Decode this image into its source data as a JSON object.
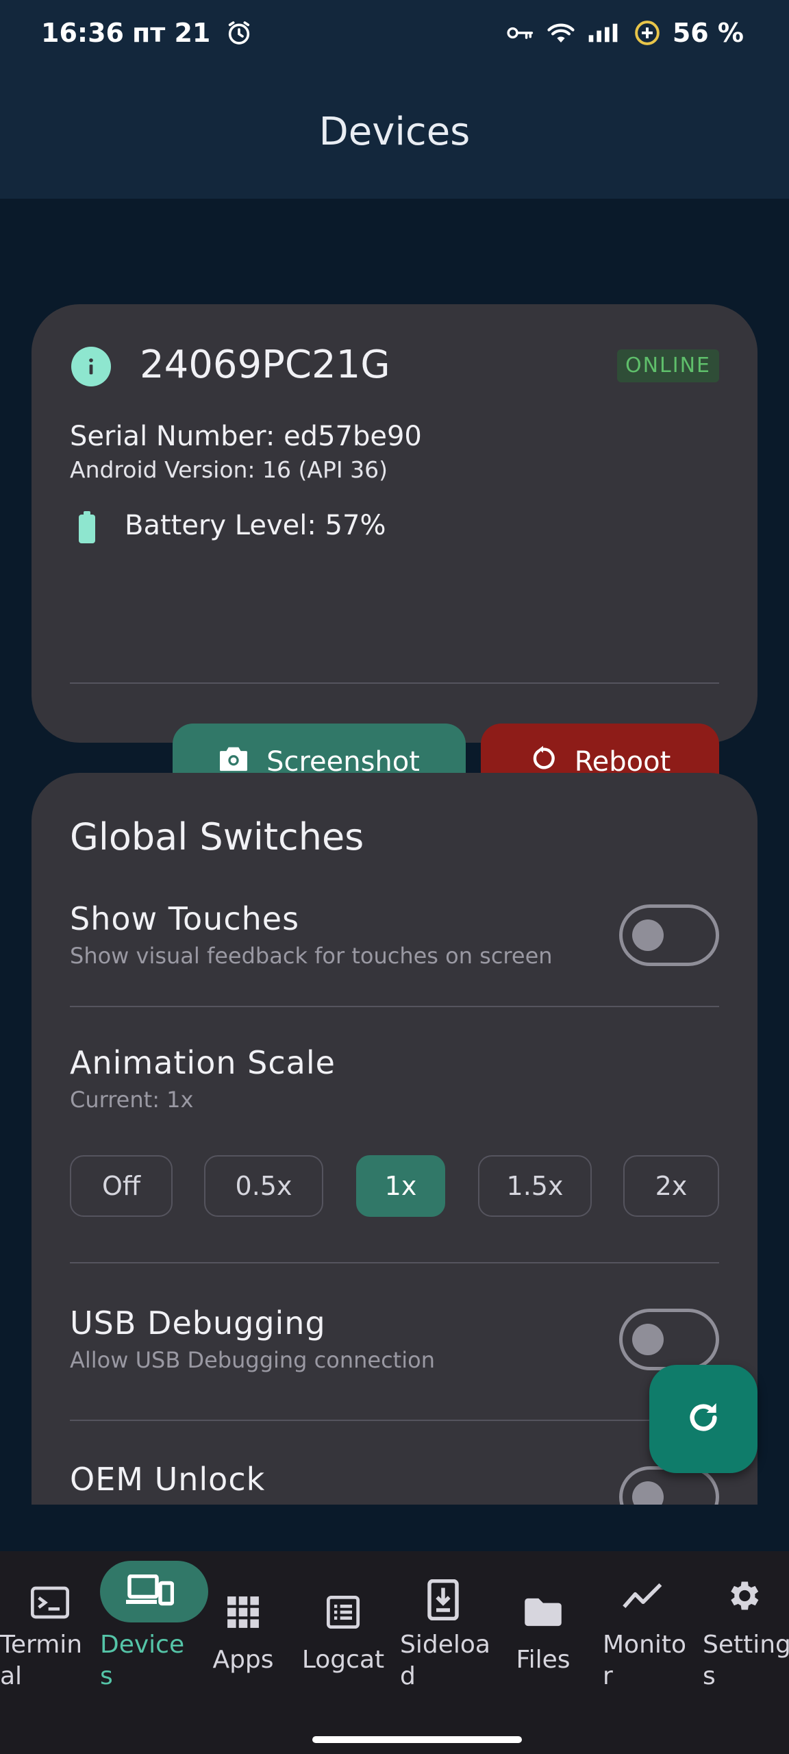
{
  "status_bar": {
    "time": "16:36",
    "date": "пт 21",
    "battery_percent": "56 %"
  },
  "app_bar": {
    "title": "Devices"
  },
  "device_card": {
    "model": "24069PC21G",
    "status": "ONLINE",
    "serial": "Serial Number: ed57be90",
    "android_version": "Android Version: 16 (API 36)",
    "battery": "Battery Level: 57%",
    "screenshot_label": "Screenshot",
    "reboot_label": "Reboot"
  },
  "switches": {
    "title": "Global Switches",
    "show_touches": {
      "title": "Show Touches",
      "subtitle": "Show visual feedback for touches on screen",
      "enabled": false
    },
    "animation_scale": {
      "title": "Animation Scale",
      "subtitle": "Current: 1x",
      "options": [
        "Off",
        "0.5x",
        "1x",
        "1.5x",
        "2x"
      ],
      "selected": "1x"
    },
    "usb_debugging": {
      "title": "USB Debugging",
      "subtitle": "Allow USB Debugging connection",
      "enabled": false
    },
    "oem_unlock": {
      "title": "OEM Unlock",
      "enabled": false
    }
  },
  "fab": {
    "icon": "refresh-icon"
  },
  "nav": {
    "items": [
      {
        "label": "Termin\nal",
        "icon": "terminal-icon"
      },
      {
        "label": "Device\ns",
        "icon": "devices-icon",
        "active": true
      },
      {
        "label": "Apps",
        "icon": "apps-grid-icon"
      },
      {
        "label": "Logcat",
        "icon": "logcat-icon"
      },
      {
        "label": "Sideloa\nd",
        "icon": "sideload-icon"
      },
      {
        "label": "Files",
        "icon": "folder-icon"
      },
      {
        "label": "Monito\nr",
        "icon": "monitor-chart-icon"
      },
      {
        "label": "Setting\ns",
        "icon": "settings-gear-icon"
      }
    ]
  },
  "colors": {
    "accent": "#317868",
    "danger": "#8e1c18",
    "card": "#36353b",
    "background": "#0a1a2a",
    "topbar": "#13273c"
  }
}
